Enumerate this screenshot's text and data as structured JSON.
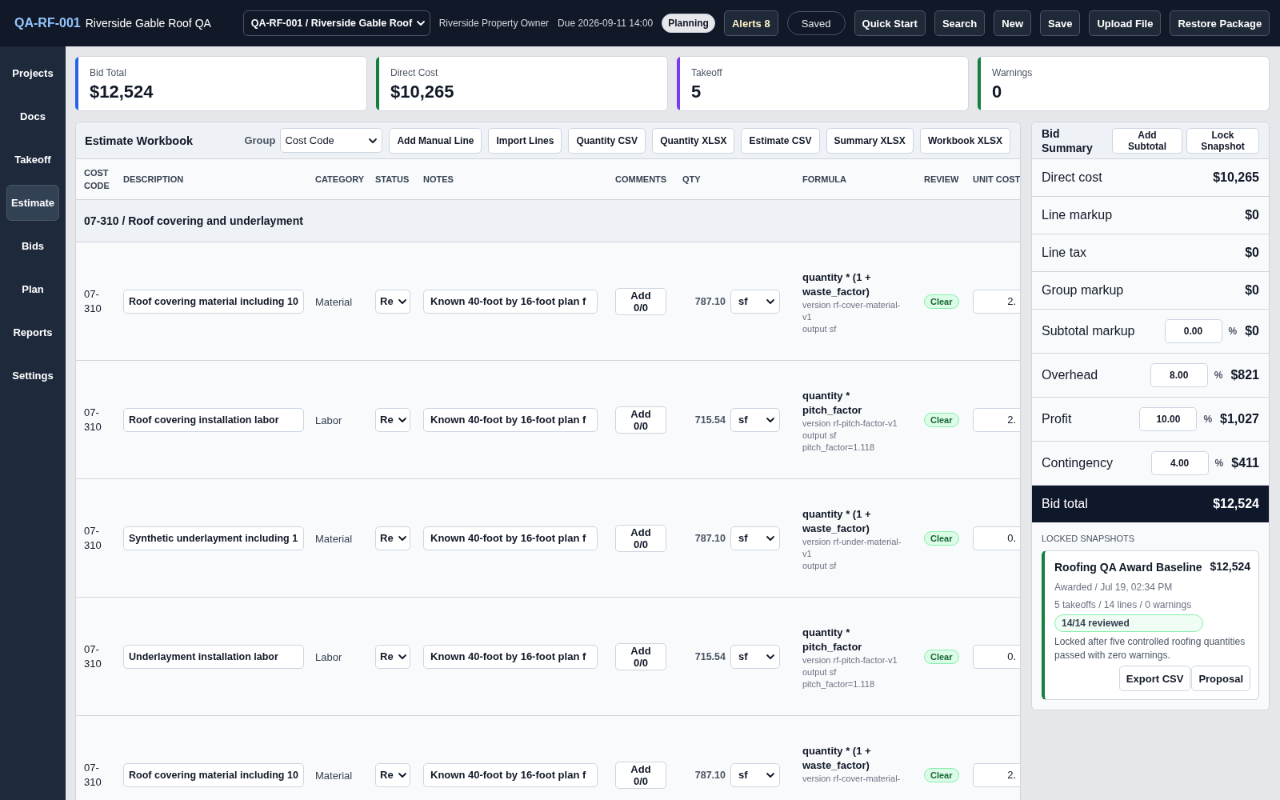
{
  "topbar": {
    "logo": "QA-RF-001",
    "title": "Riverside Gable Roof QA",
    "project_select": "QA-RF-001 / Riverside Gable Roof",
    "owner": "Riverside Property Owner",
    "due": "Due 2026-09-11 14:00",
    "phase_badge": "Planning",
    "alerts_button": "Alerts 8",
    "save_state": "Saved",
    "buttons": [
      "Quick Start",
      "Search",
      "New",
      "Save",
      "Upload File",
      "Restore Package"
    ]
  },
  "sidebar": {
    "items": [
      {
        "label": "Projects",
        "selected": false
      },
      {
        "label": "Docs",
        "selected": false
      },
      {
        "label": "Takeoff",
        "selected": false
      },
      {
        "label": "Estimate",
        "selected": true
      },
      {
        "label": "Bids",
        "selected": false
      },
      {
        "label": "Plan",
        "selected": false
      },
      {
        "label": "Reports",
        "selected": false
      },
      {
        "label": "Settings",
        "selected": false
      }
    ]
  },
  "kpis": [
    {
      "label": "Bid Total",
      "value": "$12,524",
      "color": "#2563eb"
    },
    {
      "label": "Direct Cost",
      "value": "$10,265",
      "color": "#15803d"
    },
    {
      "label": "Takeoff",
      "value": "5",
      "color": "#7c3aed"
    },
    {
      "label": "Warnings",
      "value": "0",
      "color": "#15803d"
    }
  ],
  "workbook": {
    "title": "Estimate Workbook",
    "group_label": "Group",
    "group_select": "Cost Code",
    "buttons": [
      "Add Manual Line",
      "Import Lines",
      "Quantity CSV",
      "Quantity XLSX",
      "Estimate CSV",
      "Summary XLSX",
      "Workbook XLSX"
    ],
    "columns": [
      "COST CODE",
      "DESCRIPTION",
      "CATEGORY",
      "STATUS",
      "NOTES",
      "COMMENTS",
      "QTY",
      "FORMULA",
      "REVIEW",
      "UNIT COST"
    ],
    "groups": [
      {
        "title": "07-310 / Roof covering and underlayment",
        "rows": [
          {
            "cost_code": "07-310",
            "description": "Roof covering material including 10",
            "category": "Material",
            "status": "Re",
            "notes": "Known 40-foot by 16-foot plan f",
            "comments": "Add 0/0",
            "qty": "787.10",
            "unit": "sf",
            "formula": "quantity * (1 + waste_factor)",
            "formula_meta": [
              "version rf-cover-material-v1",
              "output sf"
            ],
            "review": "Clear",
            "unit_cost": "2."
          },
          {
            "cost_code": "07-310",
            "description": "Roof covering installation labor",
            "category": "Labor",
            "status": "Re",
            "notes": "Known 40-foot by 16-foot plan f",
            "comments": "Add 0/0",
            "qty": "715.54",
            "unit": "sf",
            "formula": "quantity * pitch_factor",
            "formula_meta": [
              "version rf-pitch-factor-v1",
              "output sf",
              "pitch_factor=1.118"
            ],
            "review": "Clear",
            "unit_cost": "2."
          },
          {
            "cost_code": "07-310",
            "description": "Synthetic underlayment including 1",
            "category": "Material",
            "status": "Re",
            "notes": "Known 40-foot by 16-foot plan f",
            "comments": "Add 0/0",
            "qty": "787.10",
            "unit": "sf",
            "formula": "quantity * (1 + waste_factor)",
            "formula_meta": [
              "version rf-under-material-v1",
              "output sf"
            ],
            "review": "Clear",
            "unit_cost": "0."
          },
          {
            "cost_code": "07-310",
            "description": "Underlayment installation labor",
            "category": "Labor",
            "status": "Re",
            "notes": "Known 40-foot by 16-foot plan f",
            "comments": "Add 0/0",
            "qty": "715.54",
            "unit": "sf",
            "formula": "quantity * pitch_factor",
            "formula_meta": [
              "version rf-pitch-factor-v1",
              "output sf",
              "pitch_factor=1.118"
            ],
            "review": "Clear",
            "unit_cost": "0."
          },
          {
            "cost_code": "07-310",
            "description": "Roof covering material including 10",
            "category": "Material",
            "status": "Re",
            "notes": "Known 40-foot by 16-foot plan f",
            "comments": "Add 0/0",
            "qty": "787.10",
            "unit": "sf",
            "formula": "quantity * (1 + waste_factor)",
            "formula_meta": [
              "version rf-cover-material-"
            ],
            "review": "Clear",
            "unit_cost": "2."
          }
        ]
      }
    ]
  },
  "summary": {
    "title": "Bid Summary",
    "buttons": [
      "Add Subtotal",
      "Lock Snapshot"
    ],
    "lines": [
      {
        "kind": "amount",
        "label": "Direct cost",
        "value": "$10,265"
      },
      {
        "kind": "amount",
        "label": "Line markup",
        "value": "$0"
      },
      {
        "kind": "amount",
        "label": "Line tax",
        "value": "$0"
      },
      {
        "kind": "amount",
        "label": "Group markup",
        "value": "$0"
      },
      {
        "kind": "percent",
        "label": "Subtotal markup",
        "percent": "0.00",
        "percent_sign": "%",
        "value": "$0"
      },
      {
        "kind": "percent",
        "label": "Overhead",
        "percent": "8.00",
        "percent_sign": "%",
        "value": "$821"
      },
      {
        "kind": "percent",
        "label": "Profit",
        "percent": "10.00",
        "percent_sign": "%",
        "value": "$1,027"
      },
      {
        "kind": "percent",
        "label": "Contingency",
        "percent": "4.00",
        "percent_sign": "%",
        "value": "$411"
      }
    ],
    "total": {
      "label": "Bid total",
      "value": "$12,524"
    },
    "snapshots_label": "LOCKED SNAPSHOTS",
    "snapshots": [
      {
        "title": "Roofing QA Award Baseline",
        "amount": "$12,524",
        "meta": [
          "Awarded / Jul 19, 02:34 PM",
          "5 takeoffs / 14 lines / 0 warnings"
        ],
        "review_badge": "14/14 reviewed",
        "note": "Locked after five controlled roofing quantities passed with zero warnings.",
        "buttons": [
          "Export CSV",
          "Proposal"
        ]
      }
    ]
  }
}
